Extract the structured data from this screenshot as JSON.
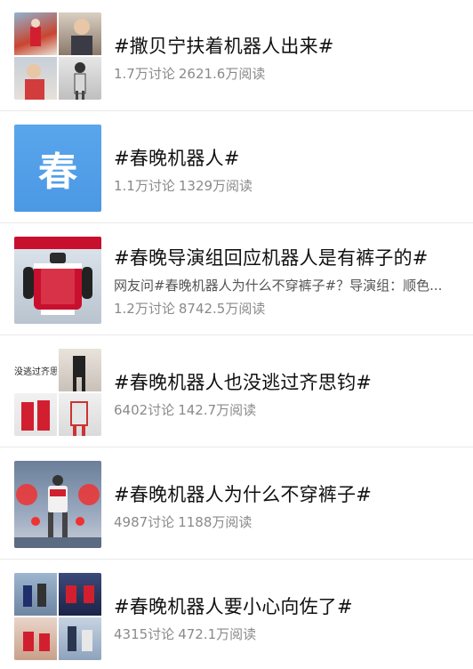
{
  "topics": [
    {
      "title": "#撒贝宁扶着机器人出来#",
      "desc": "",
      "discussions": "1.7万讨论",
      "reads": "2621.6万阅读",
      "thumb": "photo-grid-host-robot"
    },
    {
      "title": "#春晚机器人#",
      "desc": "",
      "discussions": "1.1万讨论",
      "reads": "1329万阅读",
      "thumb": "chun-character-tile",
      "thumb_char": "春"
    },
    {
      "title": "#春晚导演组回应机器人是有裤子的#",
      "desc": "网友问#春晚机器人为什么不穿裤子#？导演组：顺色...",
      "discussions": "1.2万讨论",
      "reads": "8742.5万阅读",
      "thumb": "robot-red-jacket-photo"
    },
    {
      "title": "#春晚机器人也没逃过齐思钧#",
      "desc": "",
      "discussions": "6402讨论",
      "reads": "142.7万阅读",
      "thumb": "photo-grid-dancers",
      "thumb_caption": "没逃过齐思"
    },
    {
      "title": "#春晚机器人为什么不穿裤子#",
      "desc": "",
      "discussions": "4987讨论",
      "reads": "1188万阅读",
      "thumb": "robot-stage-photo"
    },
    {
      "title": "#春晚机器人要小心向佐了#",
      "desc": "",
      "discussions": "4315讨论",
      "reads": "472.1万阅读",
      "thumb": "photo-grid-robots"
    }
  ],
  "colors": {
    "title": "#111111",
    "stats": "#8a8a8a",
    "chun_tile": "#4b98e4"
  }
}
